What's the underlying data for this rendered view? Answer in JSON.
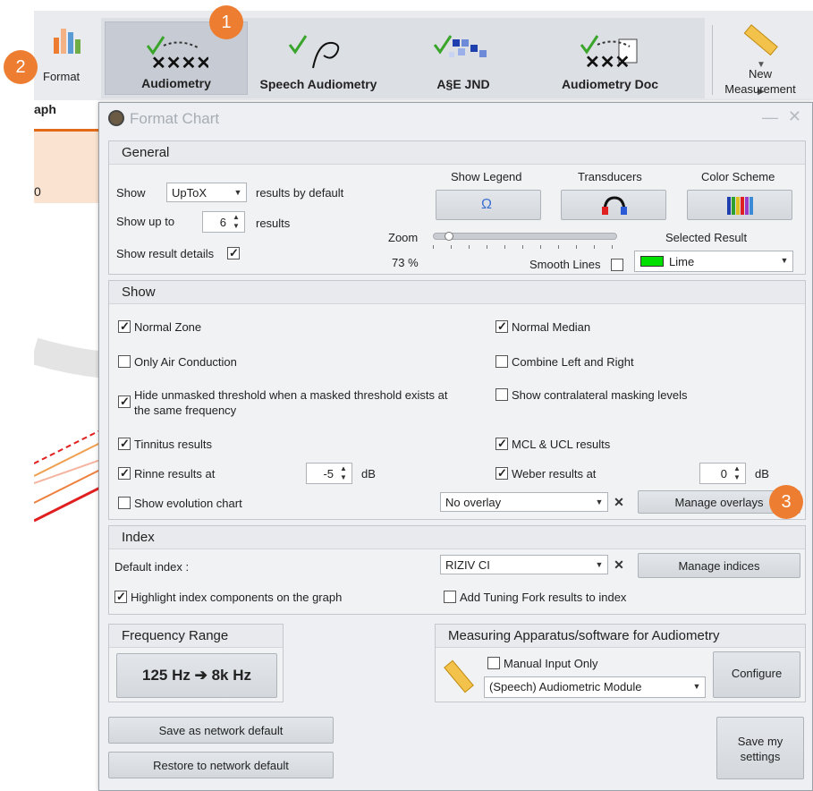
{
  "ribbon": {
    "format_label": "Format",
    "group_label": "aph",
    "gallery": [
      {
        "label": "Audiometry",
        "selected": true
      },
      {
        "label": "Speech Audiometry",
        "selected": false
      },
      {
        "label": "A§E JND",
        "selected": false
      },
      {
        "label": "Audiometry Doc",
        "selected": false
      }
    ],
    "new_measurement": "New\nMeasurement",
    "new_measurement_l1": "New",
    "new_measurement_l2": "Measurement"
  },
  "graph_hint": {
    "zero_label": "0"
  },
  "callouts": [
    "1",
    "2",
    "3"
  ],
  "dialog": {
    "title": "Format Chart",
    "general": {
      "header": "General",
      "show_label": "Show",
      "show_value": "UpToX",
      "show_suffix": "results by default",
      "show_up_to_label": "Show up to",
      "show_up_to_value": "6",
      "show_up_to_suffix": "results",
      "show_result_details": "Show result details",
      "show_legend": "Show Legend",
      "transducers": "Transducers",
      "color_scheme": "Color Scheme",
      "zoom_label": "Zoom",
      "zoom_value": "73 %",
      "zoom_fraction": 0.06,
      "smooth_lines": "Smooth Lines",
      "selected_result_label": "Selected Result",
      "selected_result_value": "Lime",
      "selected_result_color": "#00e000"
    },
    "show": {
      "header": "Show",
      "normal_zone": "Normal Zone",
      "normal_median": "Normal Median",
      "only_air": "Only Air Conduction",
      "combine_lr": "Combine Left and Right",
      "hide_unmasked_1": "Hide unmasked threshold when a masked threshold exists at",
      "hide_unmasked_2": "the same frequency",
      "show_contra": "Show contralateral masking levels",
      "tinnitus": "Tinnitus results",
      "mcl_ucl": "MCL & UCL results",
      "rinne": "Rinne results at",
      "rinne_value": "-5",
      "weber": "Weber results at",
      "weber_value": "0",
      "db": "dB",
      "evolution": "Show evolution chart",
      "overlay_value": "No overlay",
      "manage_overlays": "Manage overlays"
    },
    "index": {
      "header": "Index",
      "default_index_label": "Default index :",
      "default_index_value": "RIZIV CI",
      "manage_indices": "Manage indices",
      "highlight": "Highlight index components on the graph",
      "add_tuning": "Add Tuning Fork results to index"
    },
    "frequency": {
      "header": "Frequency Range",
      "range": "125 Hz ➔ 8k Hz"
    },
    "apparatus": {
      "header": "Measuring Apparatus/software for Audiometry",
      "manual_input": "Manual Input Only",
      "module_value": "(Speech) Audiometric Module",
      "configure": "Configure"
    },
    "footer": {
      "save_network": "Save as network default",
      "restore_network": "Restore to network default",
      "save_my_1": "Save my",
      "save_my_2": "settings"
    }
  }
}
